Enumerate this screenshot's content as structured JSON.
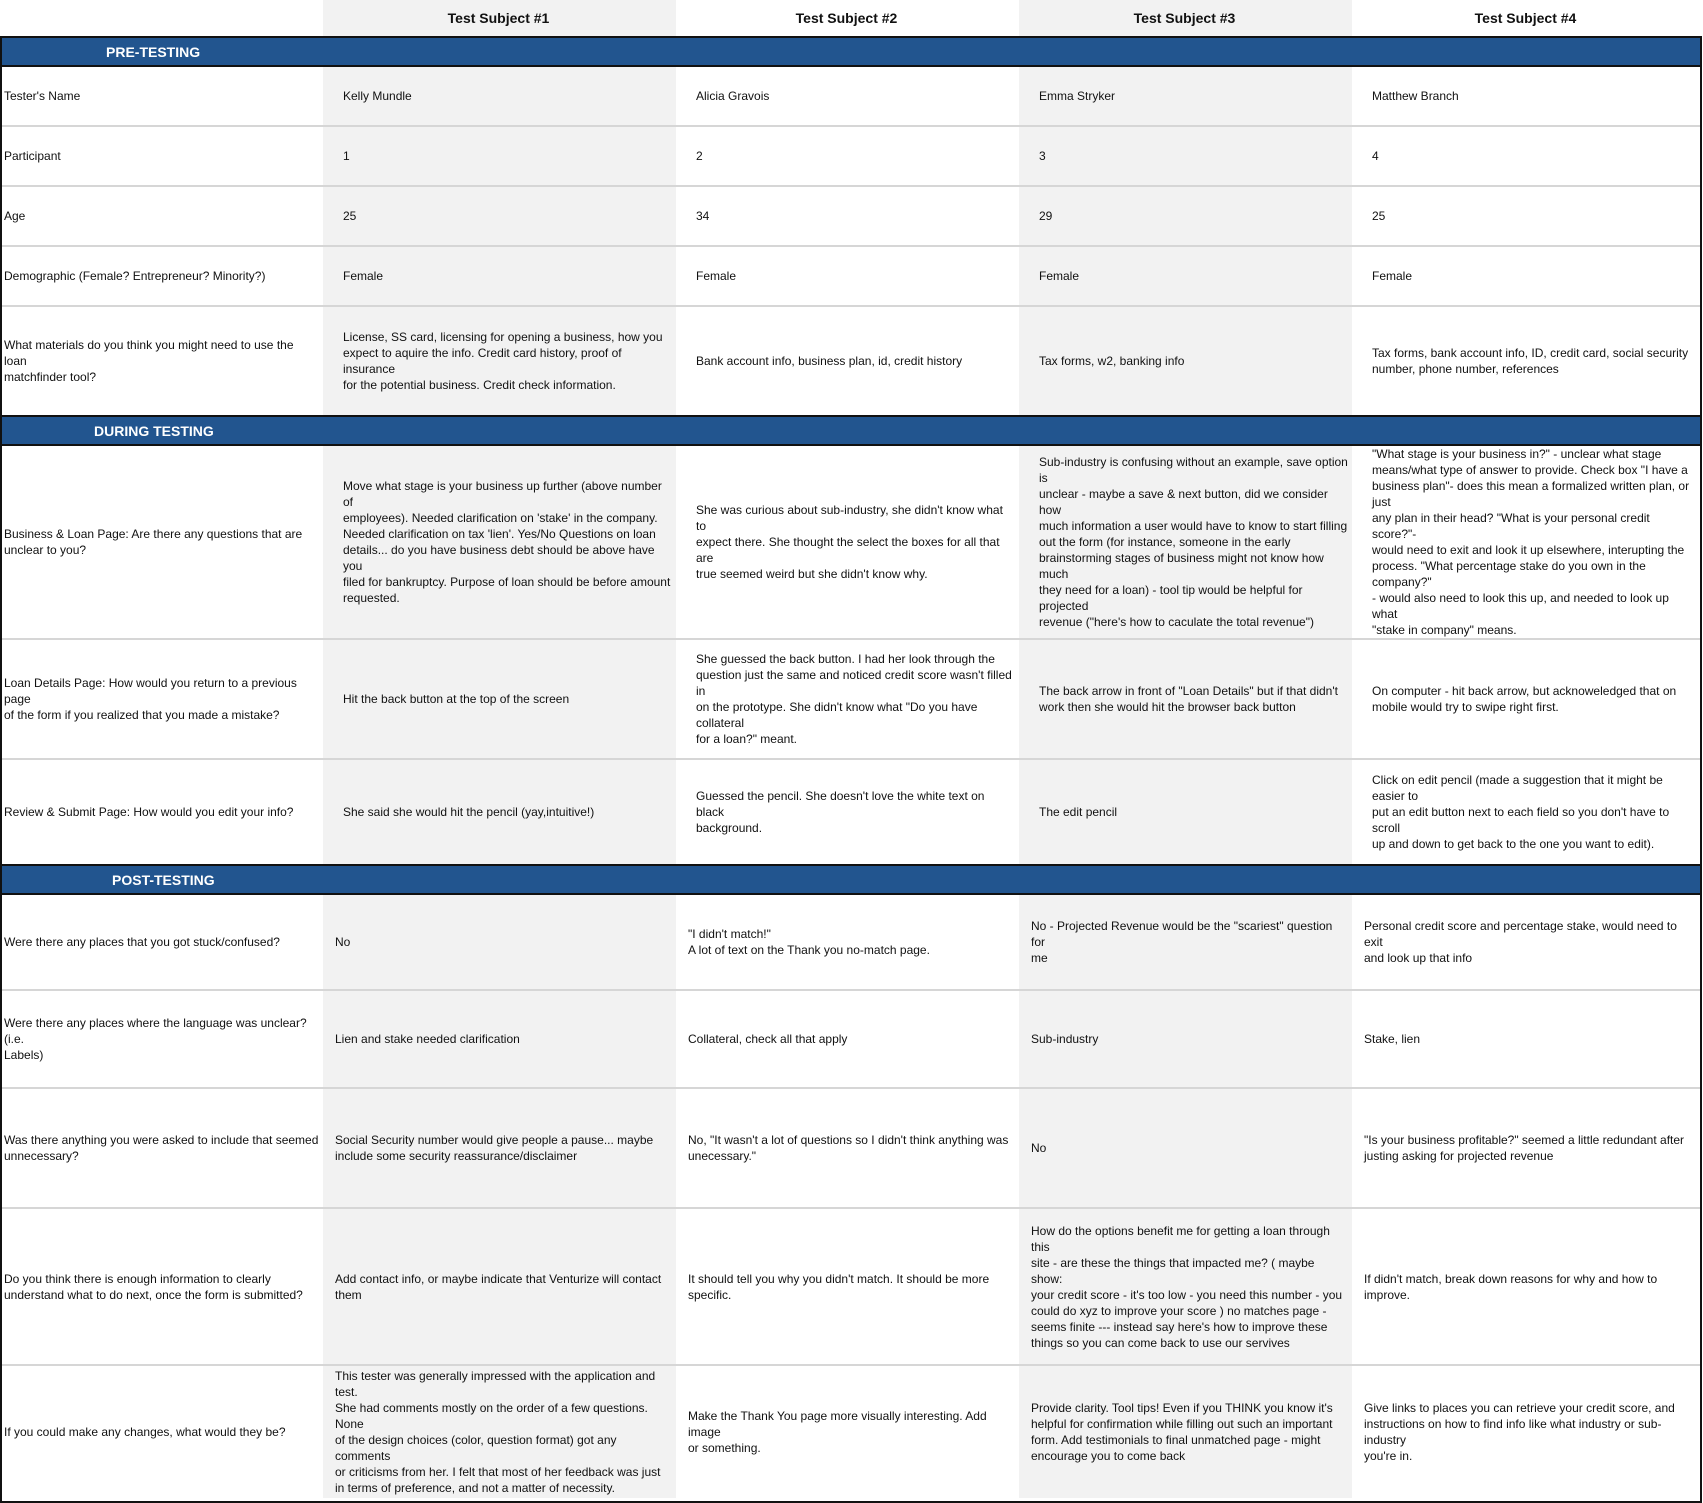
{
  "headers": [
    "",
    "Test Subject #1",
    "Test Subject #2",
    "Test Subject #3",
    "Test Subject #4"
  ],
  "sections": {
    "pre": {
      "title": "PRE-TESTING",
      "rows": [
        {
          "label": "Tester's Name",
          "values": [
            "Kelly Mundle",
            "Alicia Gravois",
            "Emma Stryker",
            "Matthew Branch"
          ]
        },
        {
          "label": "Participant",
          "values": [
            "1",
            "2",
            "3",
            "4"
          ]
        },
        {
          "label": "Age",
          "values": [
            "25",
            "34",
            "29",
            "25"
          ]
        },
        {
          "label": "Demographic (Female? Entrepreneur? Minority?)",
          "values": [
            "Female",
            "Female",
            "Female",
            "Female"
          ]
        },
        {
          "label": "What materials do you think you might need to use the loan\nmatchfinder tool?",
          "values": [
            "License, SS card, licensing for opening a business, how you\nexpect to aquire the info. Credit card history, proof of insurance\nfor the potential business. Credit check information.",
            "Bank account info, business plan, id, credit history",
            "Tax forms, w2, banking info",
            "Tax forms, bank account info, ID, credit card, social security\nnumber, phone number,  references"
          ]
        }
      ]
    },
    "during": {
      "title": "DURING TESTING",
      "rows": [
        {
          "label": "Business & Loan Page: Are there any questions that are\nunclear to you?",
          "values": [
            "Move what stage is your business up further (above number of\nemployees). Needed clarification on 'stake' in the company.\nNeeded clarification on tax 'lien'. Yes/No Questions on loan\ndetails... do you have business debt should be above have you\nfiled for bankruptcy. Purpose of loan should be before amount\nrequested.",
            "She was curious about sub-industry, she didn't know what to\nexpect there.  She thought the select the boxes for all that are\ntrue seemed weird but she didn't know why.",
            "Sub-industry is confusing without an example, save option is\nunclear - maybe a save & next button,  did we consider how\nmuch information a user would have to know to start filling\nout the form (for instance, someone in the early\nbrainstorming stages of business might not know how much\nthey need for a loan) - tool tip would be helpful for projected\nrevenue (\"here's how to caculate the total revenue\")",
            "\"What stage is your business in?\" - unclear what stage\nmeans/what type of answer to provide. Check box \"I have a\nbusiness plan\"- does this mean a formalized written plan, or just\nany plan in their head? \"What is your personal credit score?\"-\nwould need to exit and look it up elsewhere, interupting the\nprocess. \"What percentage stake do you own in the company?\"\n- would also need to look this up, and needed to look up what\n\"stake in company\" means."
          ]
        },
        {
          "label": "Loan Details Page: How would you return to a previous page\nof the form if you realized that you made a mistake?",
          "values": [
            "Hit the back button at the top of the screen",
            "She guessed the back button.  I had her look through the\nquestion just the same and noticed credit score wasn't filled in\non the prototype. She didn't know what \"Do you have collateral\nfor a loan?\" meant.",
            "The back arrow in front of \"Loan Details\" but if that didn't\nwork then she would hit the browser back button",
            "On computer - hit back arrow, but acknoweledged that on\nmobile would try to swipe right first."
          ]
        },
        {
          "label": "Review & Submit Page: How would you edit your info?",
          "values": [
            "She said she would hit the pencil (yay,intuitive!)",
            "Guessed the pencil.  She doesn't love the white text on black\nbackground.",
            "The edit pencil",
            "Click on edit pencil (made a suggestion that it might be easier to\nput an edit button next to each field so you don't have to scroll\nup and down to get back to the one you want to edit)."
          ]
        }
      ]
    },
    "post": {
      "title": "POST-TESTING",
      "rows": [
        {
          "label": "Were there any places that you got stuck/confused?",
          "values": [
            "No",
            "\"I didn't match!\"\nA lot of text on the Thank you no-match page.",
            "No - Projected Revenue would be the \"scariest\" question for\nme",
            "Personal credit score and percentage stake, would need to exit\nand look up that info"
          ]
        },
        {
          "label": "Were there any places where the language was unclear? (i.e.\nLabels)",
          "values": [
            "Lien and stake needed clarification",
            "Collateral, check all that apply",
            "Sub-industry",
            "Stake, lien"
          ]
        },
        {
          "label": "Was there anything you were asked to include that seemed\nunnecessary?",
          "values": [
            "Social Security number would give people a pause... maybe\ninclude some security reassurance/disclaimer",
            "No, \"It wasn't a lot of questions so I didn't think anything was\nunecessary.\"",
            "No",
            "\"Is your business profitable?\" seemed a little redundant after\njusting asking for projected revenue"
          ]
        },
        {
          "label": "Do you think there is enough information to clearly\nunderstand what to do next, once the form is submitted?",
          "values": [
            "Add contact info, or maybe indicate that Venturize will contact\nthem",
            "It should tell you why you didn't match.  It should be more\nspecific.",
            "How do the options benefit me for getting a loan through this\nsite - are these the things that impacted me? ( maybe show:\nyour credit score - it's too low - you need this number - you\ncould do xyz to improve your score ) no matches page -\nseems finite --- instead say here's how to improve these\nthings so you can come back to use our servives",
            "If didn't match, break down reasons for why and how to improve."
          ]
        },
        {
          "label": "If you could make any changes, what would they be?",
          "values": [
            "This tester was generally impressed with the application and test.\nShe had comments mostly on the order of a few questions. None\nof the design choices (color, question format) got any comments\nor criticisms from her. I felt that most of her feedback was just\nin terms of preference, and not a matter of necessity.",
            "Make the Thank You page more visually interesting. Add image\nor something.",
            "Provide clarity. Tool tips! Even if you THINK you know it's\nhelpful for confirmation while filling out such an important\nform. Add testimonials to final unmatched page - might\nencourage you to come back",
            "Give links to places you can retrieve your credit score, and\ninstructions on how to find info like what industry or sub-industry\nyou're in."
          ]
        }
      ]
    }
  },
  "colors": {
    "section_band": "#22558f",
    "shaded_column": "#f2f2f2",
    "border": "#111111"
  }
}
